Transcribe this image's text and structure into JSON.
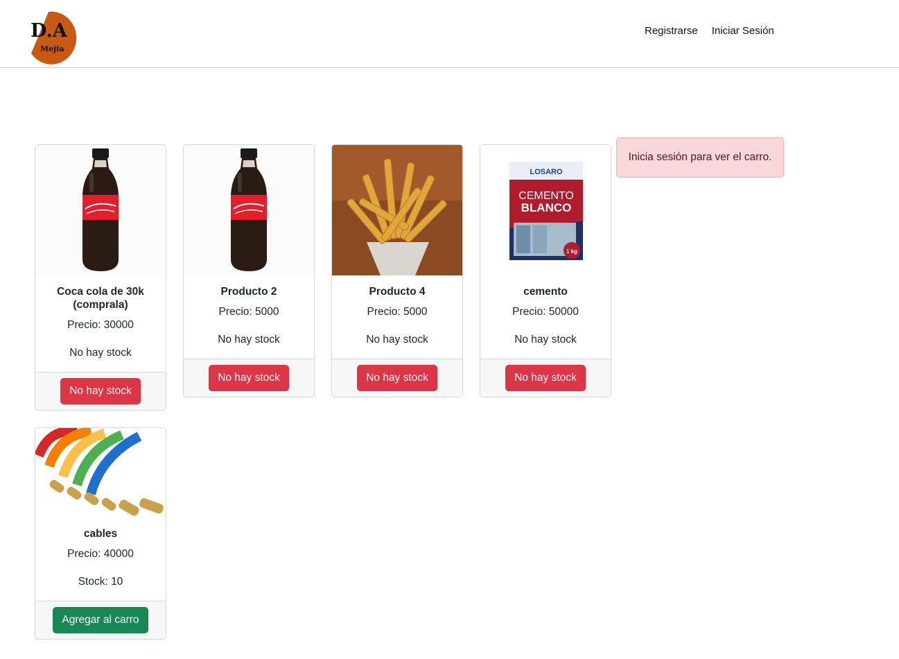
{
  "brand": {
    "logo_main": "D.A",
    "logo_sub": "Mejia",
    "logo_color": "#c85a14"
  },
  "nav": {
    "register": "Registrarse",
    "login": "Iniciar Sesión"
  },
  "alert": {
    "message": "Inicia sesión para ver el carro."
  },
  "products": [
    {
      "image": "coca-cola-bottle",
      "title": "Coca cola de 30k (comprala)",
      "price": "Precio: 30000",
      "stock": "No hay stock",
      "button": "No hay stock"
    },
    {
      "image": "coca-cola-bottle",
      "title": "Producto 2",
      "price": "Precio: 5000",
      "stock": "No hay stock",
      "button": "No hay stock"
    },
    {
      "image": "french-fries",
      "title": "Producto 4",
      "price": "Precio: 5000",
      "stock": "No hay stock",
      "button": "No hay stock"
    },
    {
      "image": "cement-bag",
      "title": "cemento",
      "price": "Precio: 50000",
      "stock": "No hay stock",
      "button": "No hay stock",
      "package_text": {
        "brand": "LOSARO",
        "line1": "CEMENTO",
        "line2": "BLANCO",
        "weight": "1 kg"
      }
    },
    {
      "image": "colored-cables",
      "title": "cables",
      "price": "Precio: 40000",
      "stock": "Stock: 10",
      "button": "Agregar al carro"
    }
  ],
  "colors": {
    "danger": "#dc3545",
    "success": "#198754",
    "alert_bg": "#f8d7da"
  }
}
